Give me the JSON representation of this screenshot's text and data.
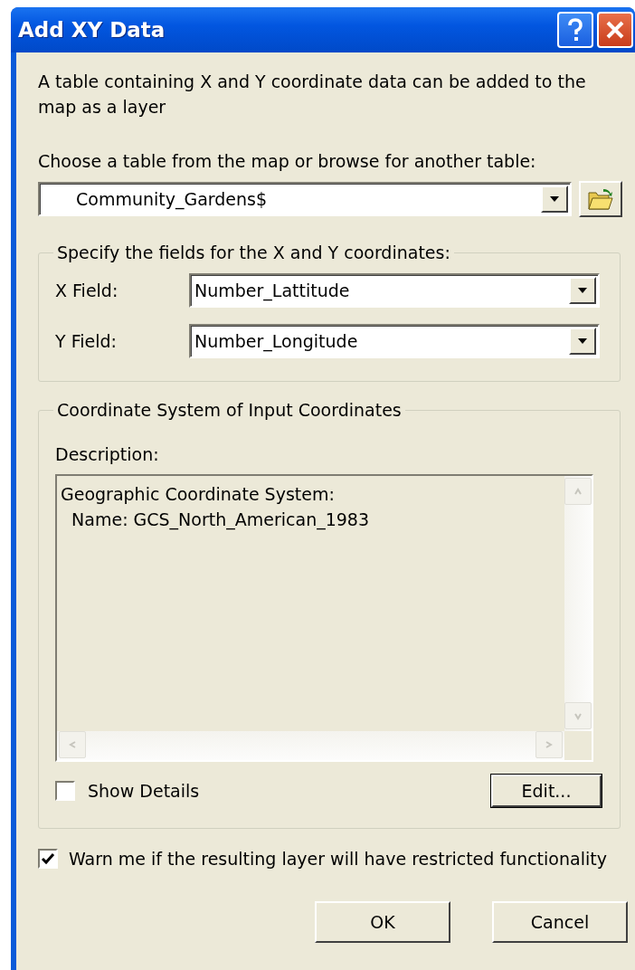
{
  "window": {
    "title": "Add XY Data"
  },
  "intro": "A table containing X and Y coordinate data can be added to the map as a layer",
  "table_prompt": "Choose a table from the map or browse for another table:",
  "table_combo": {
    "value": "Community_Gardens$"
  },
  "fields_group": {
    "title": "Specify the fields for the X and Y coordinates:",
    "fields": [
      {
        "label": "X Field:",
        "value": "Number_Lattitude"
      },
      {
        "label": "Y Field:",
        "value": "Number_Longitude"
      }
    ]
  },
  "coordinate_group": {
    "title": "Coordinate System of Input Coordinates",
    "description_label": "Description:",
    "description_lines": [
      "Geographic Coordinate System:",
      "  Name: GCS_North_American_1983"
    ],
    "show_details": {
      "label": "Show Details",
      "checked": false
    },
    "edit_button": "Edit..."
  },
  "warn_checkbox": {
    "label": "Warn me if the resulting layer will have restricted functionality",
    "checked": true
  },
  "buttons": [
    "OK",
    "Cancel"
  ]
}
